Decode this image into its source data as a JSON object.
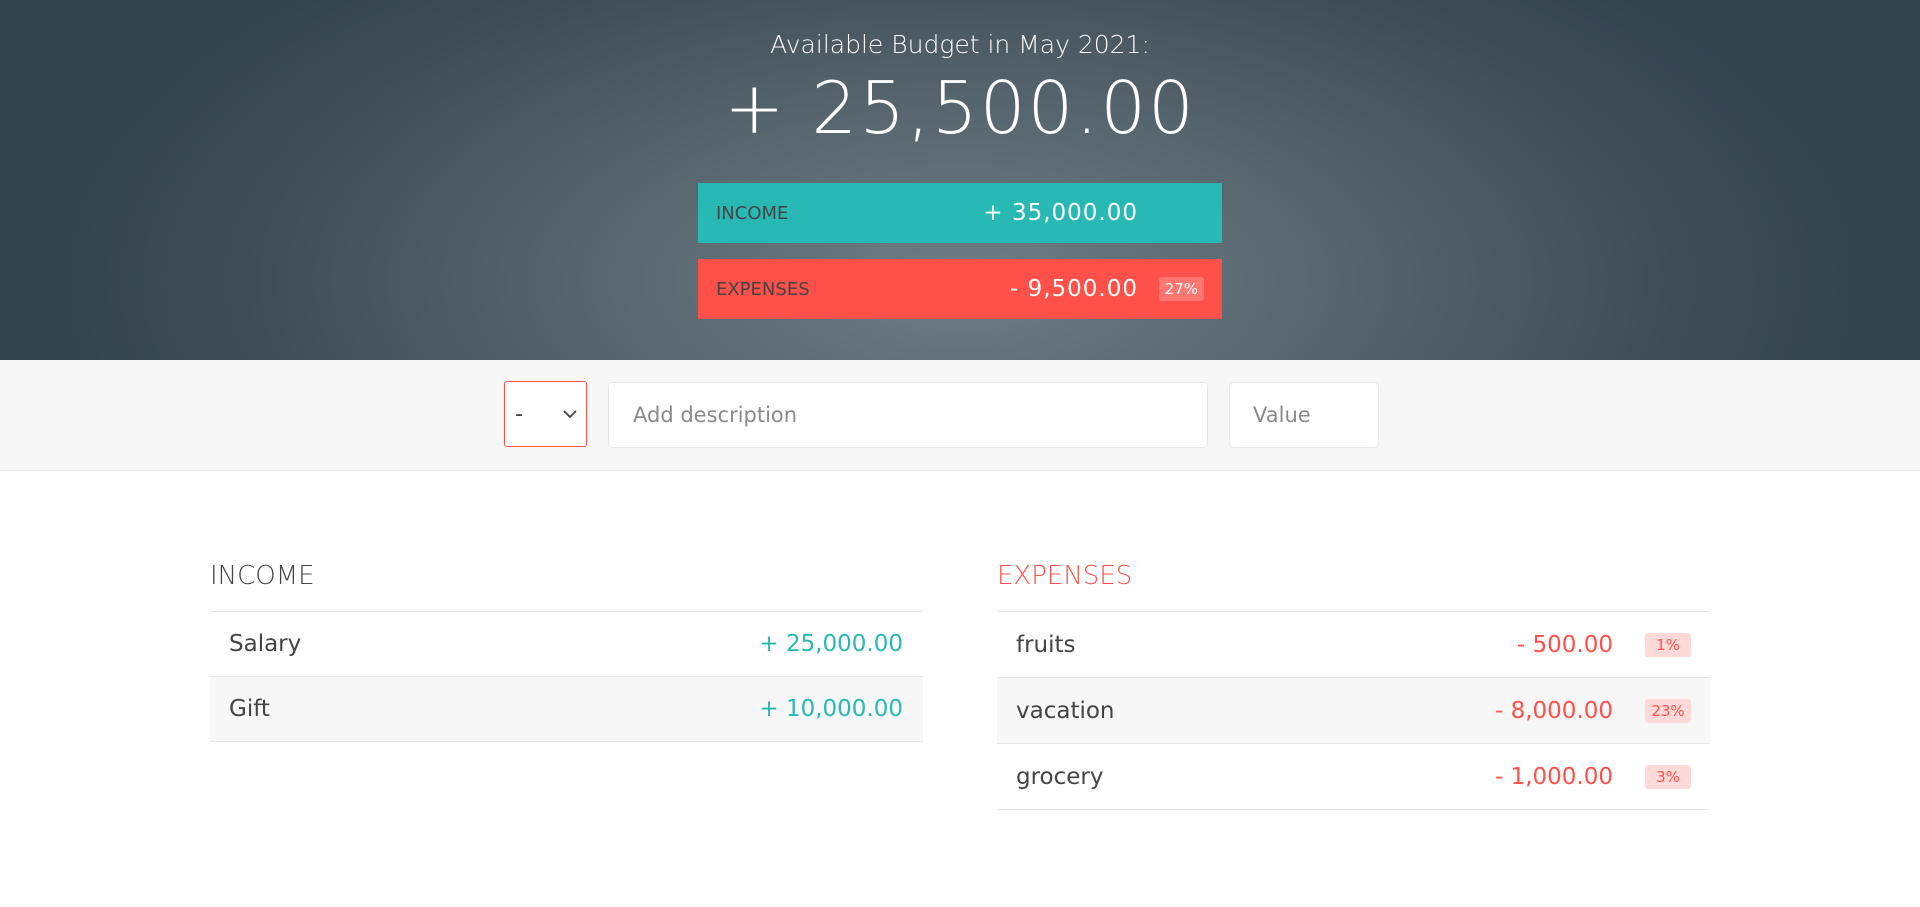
{
  "header": {
    "budget_title": "Available Budget in May 2021:",
    "budget_value": "+ 25,500.00",
    "income": {
      "label": "Income",
      "value": "+ 35,000.00"
    },
    "expenses": {
      "label": "Expenses",
      "value": "- 9,500.00",
      "percentage": "27%"
    }
  },
  "add_form": {
    "type_selected": "-",
    "description_placeholder": "Add description",
    "value_placeholder": "Value"
  },
  "income_list": {
    "title": "Income",
    "items": [
      {
        "description": "Salary",
        "value": "+ 25,000.00"
      },
      {
        "description": "Gift",
        "value": "+ 10,000.00"
      }
    ]
  },
  "expenses_list": {
    "title": "Expenses",
    "items": [
      {
        "description": "fruits",
        "value": "- 500.00",
        "percentage": "1%"
      },
      {
        "description": "vacation",
        "value": "- 8,000.00",
        "percentage": "23%"
      },
      {
        "description": "grocery",
        "value": "- 1,000.00",
        "percentage": "3%"
      }
    ]
  },
  "colors": {
    "income_accent": "#28b9b5",
    "expense_accent": "#ff5049",
    "header_bg": "#4c5a64"
  }
}
